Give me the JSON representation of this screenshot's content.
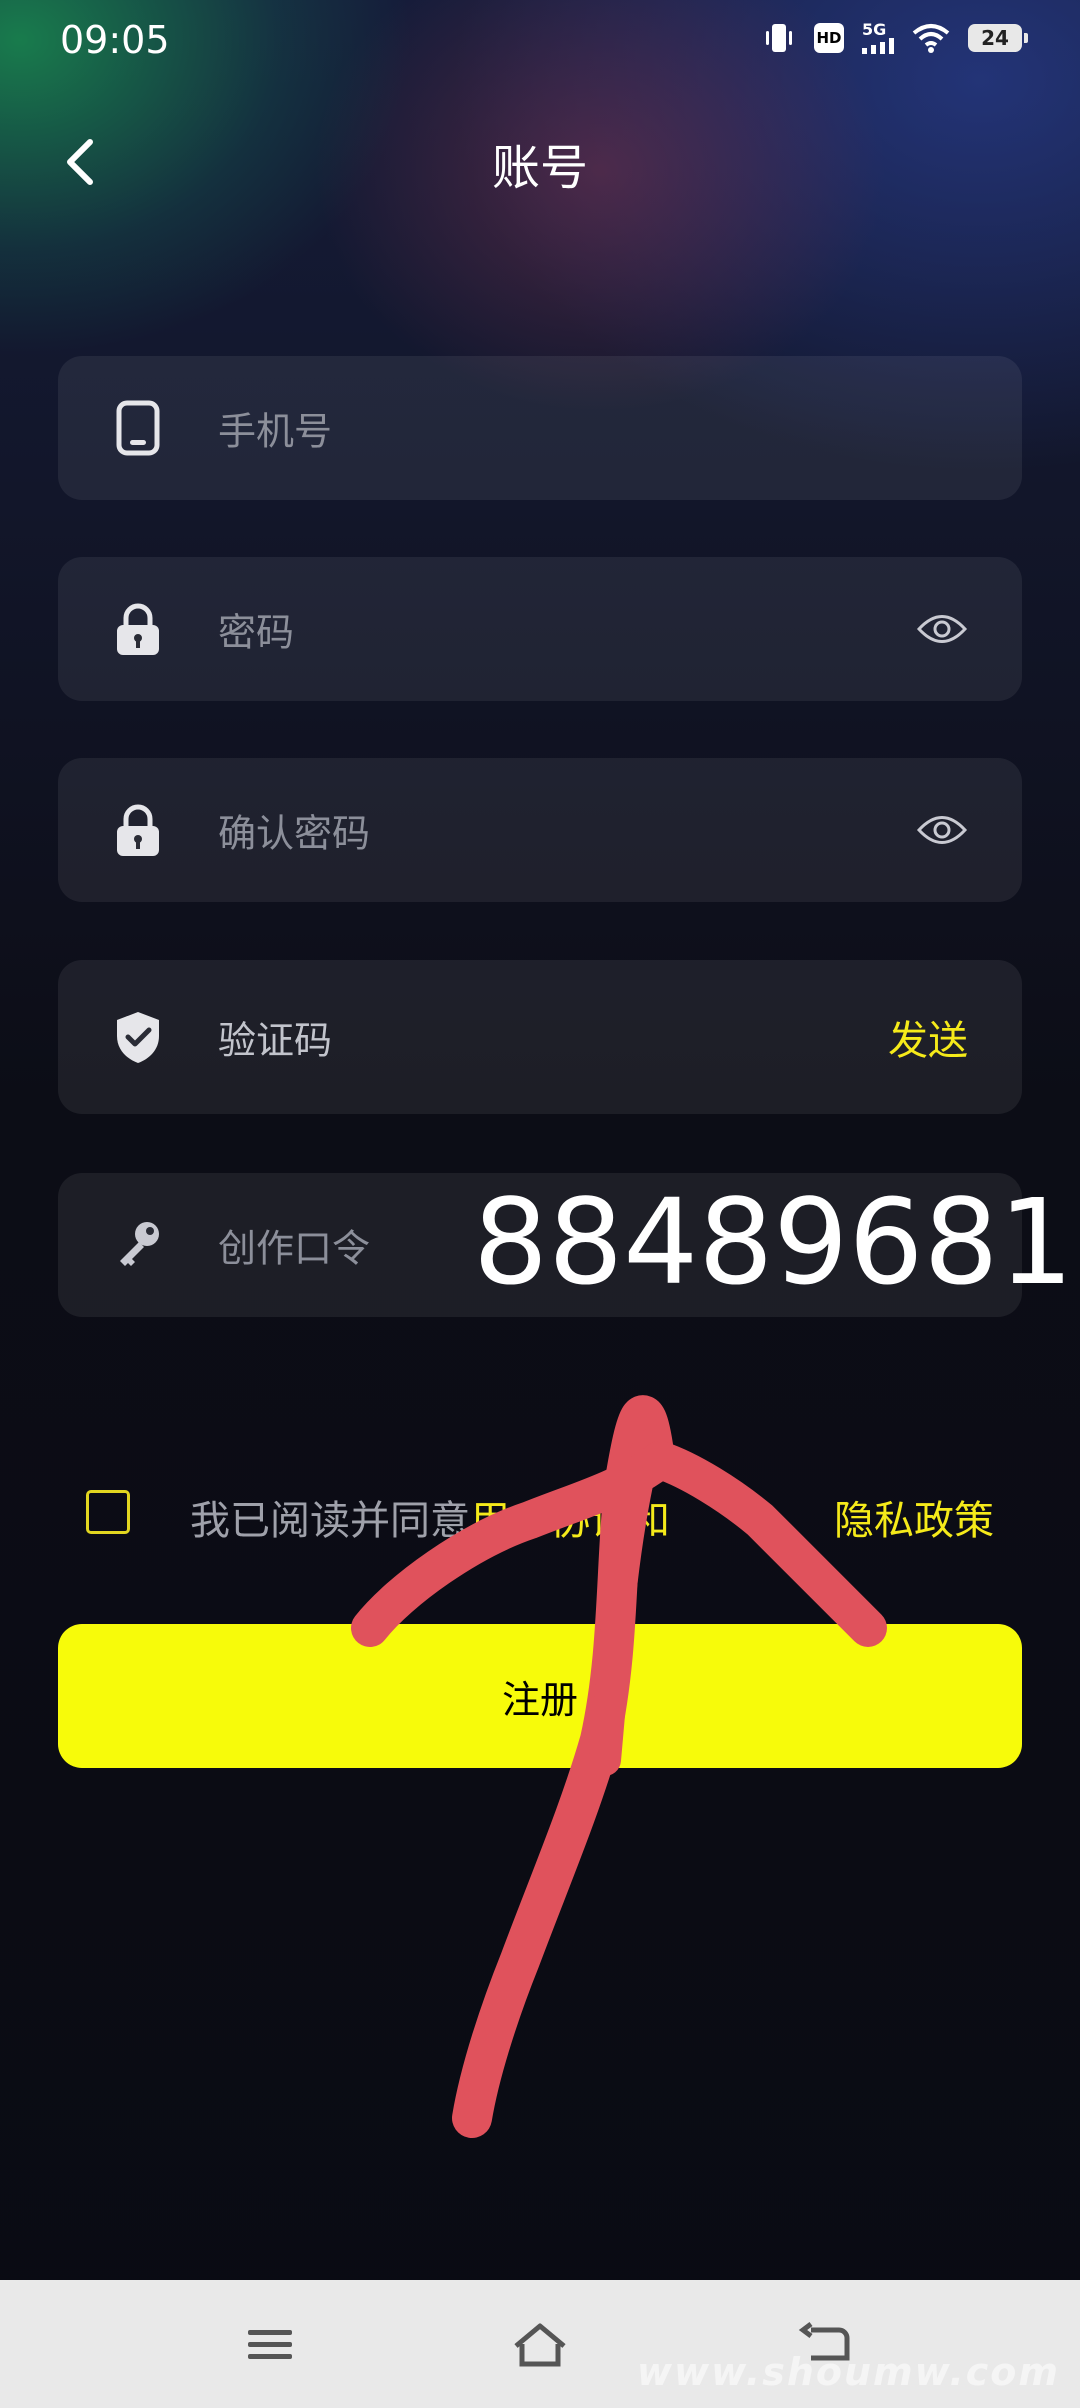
{
  "status_bar": {
    "time": "09:05",
    "network": "5G",
    "hd": "HD",
    "battery": "24"
  },
  "header": {
    "title": "账号"
  },
  "form": {
    "phone_placeholder": "手机号",
    "password_placeholder": "密码",
    "confirm_password_placeholder": "确认密码",
    "verification_placeholder": "验证码",
    "send_label": "发送",
    "creation_code_label": "创作口令",
    "creation_code_value": "88489681"
  },
  "agreement": {
    "prefix": "我已阅读并同意",
    "user_agreement": "用户协议",
    "and": "和",
    "privacy_policy": "隐私政策"
  },
  "register_button": "注册",
  "watermark": "www.shoumw.com",
  "colors": {
    "accent": "#f7fb0a",
    "link": "#f5ea1a",
    "annotation": "#e0525c"
  }
}
